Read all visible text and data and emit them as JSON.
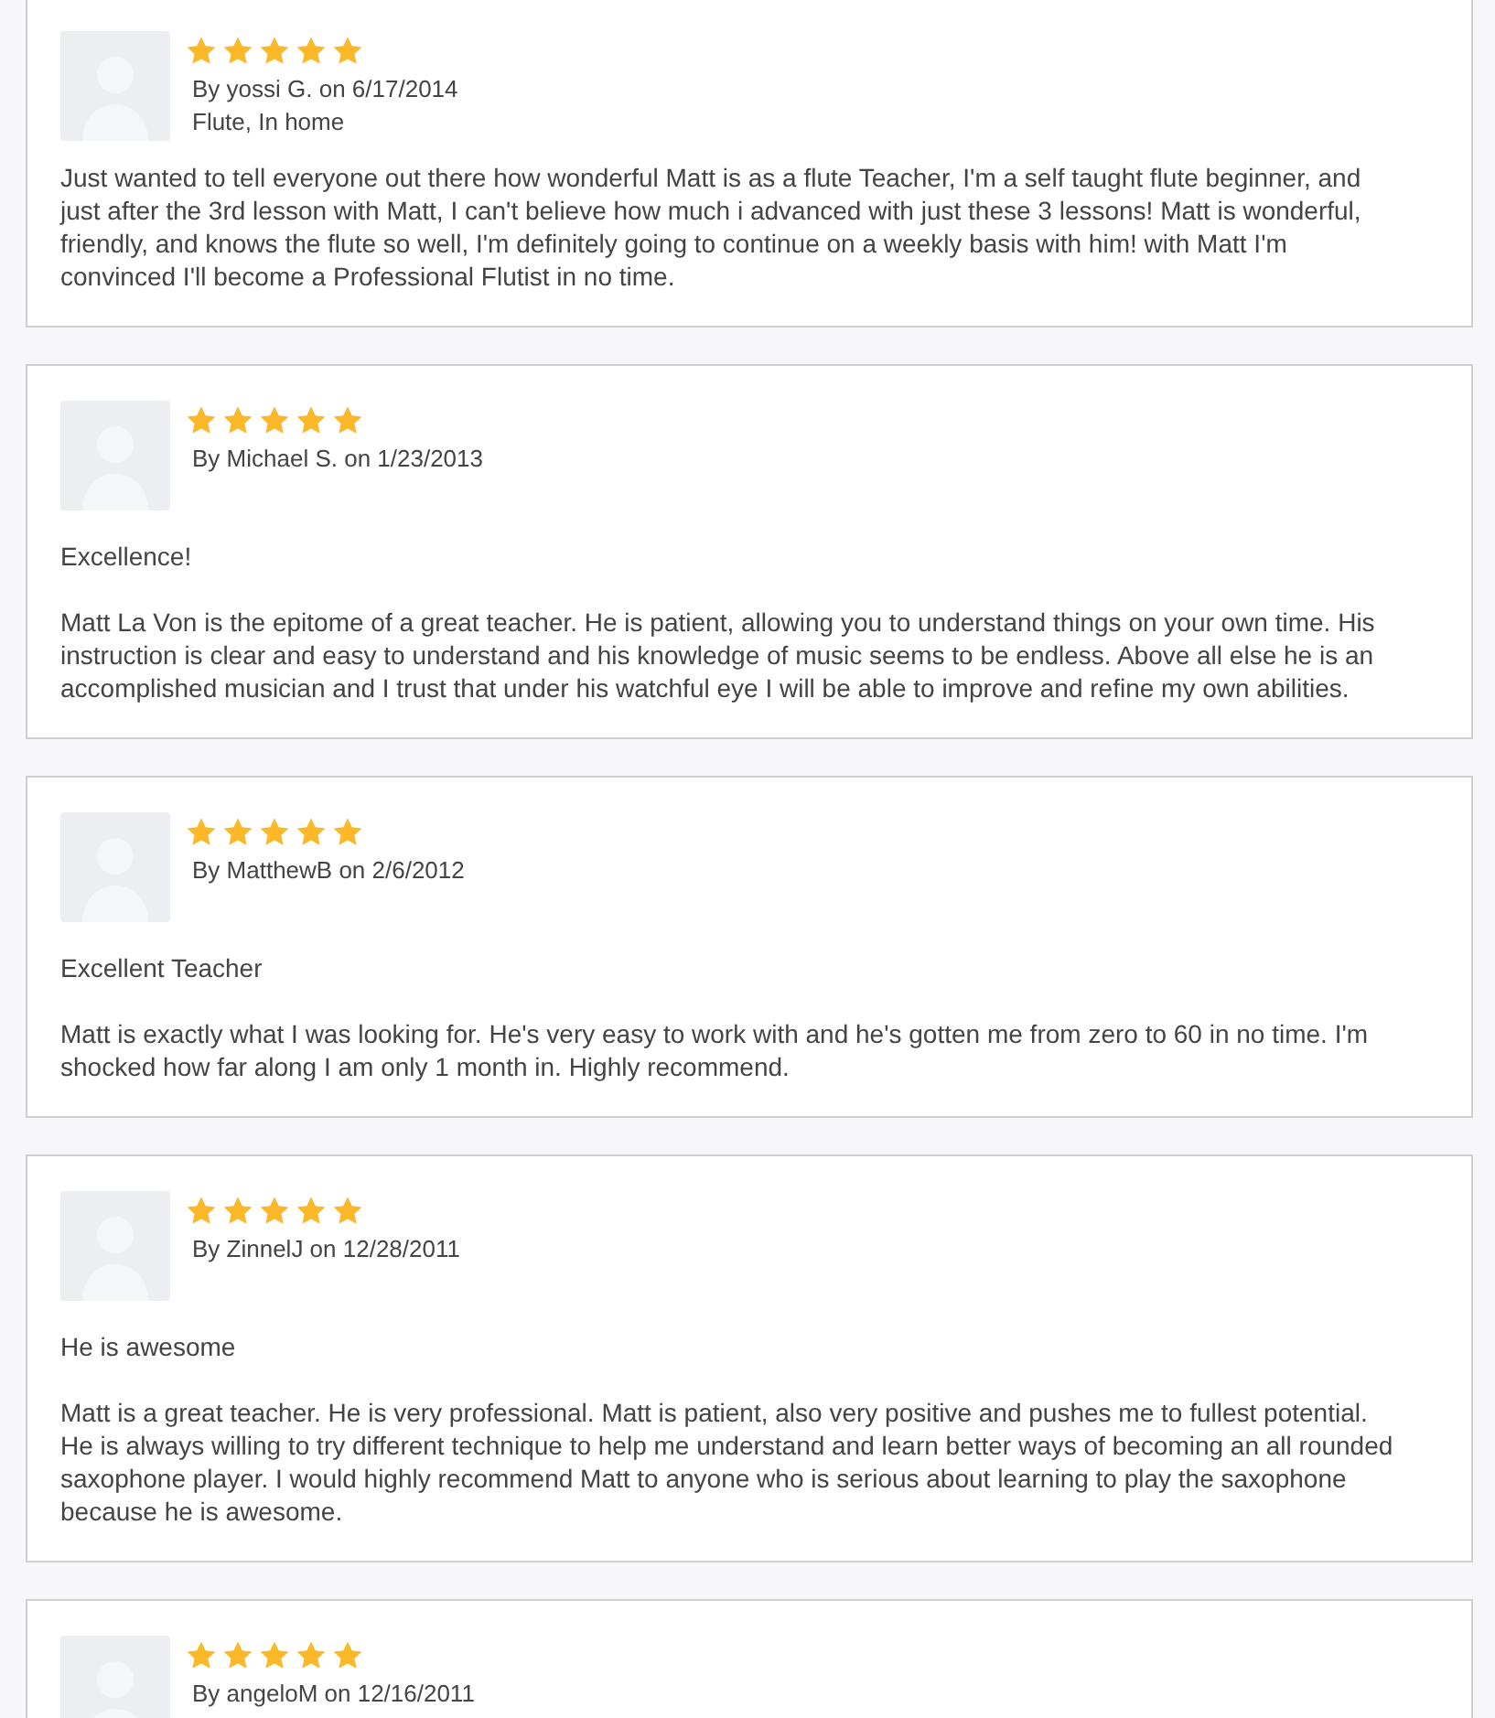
{
  "reviews": [
    {
      "stars": 5,
      "byline": "By yossi G. on 6/17/2014",
      "detail": "Flute, In home",
      "body": "Just wanted to tell everyone out there how wonderful Matt is as a flute Teacher, I'm a self taught flute beginner, and just after the 3rd lesson with Matt, I can't believe how much i advanced with just these 3 lessons! Matt is wonderful, friendly, and knows the flute so well, I'm definitely going to continue on a weekly basis with him! with Matt I'm convinced I'll become a Professional Flutist in no time."
    },
    {
      "stars": 5,
      "byline": "By Michael S. on 1/23/2013",
      "title": "Excellence!",
      "body": "Matt La Von is the epitome of a great teacher. He is patient, allowing you to understand things on your own time. His instruction is clear and easy to understand and his knowledge of music seems to be endless. Above all else he is an accomplished musician and I trust that under his watchful eye I will be able to improve and refine my own abilities."
    },
    {
      "stars": 5,
      "byline": "By MatthewB on 2/6/2012",
      "title": "Excellent Teacher",
      "body": "Matt is exactly what I was looking for. He's very easy to work with and he's gotten me from zero to 60 in no time. I'm shocked how far along I am only 1 month in. Highly recommend."
    },
    {
      "stars": 5,
      "byline": "By ZinnelJ on 12/28/2011",
      "title": "He is awesome",
      "body": "Matt is a great teacher. He is very professional. Matt is patient, also very positive and pushes me to fullest potential. He is always willing to try different technique to help me understand and learn better ways of becoming an all rounded saxophone player. I would highly recommend Matt to anyone who is serious about learning to play the saxophone because he is awesome."
    },
    {
      "stars": 5,
      "byline": "By angeloM on 12/16/2011"
    }
  ]
}
